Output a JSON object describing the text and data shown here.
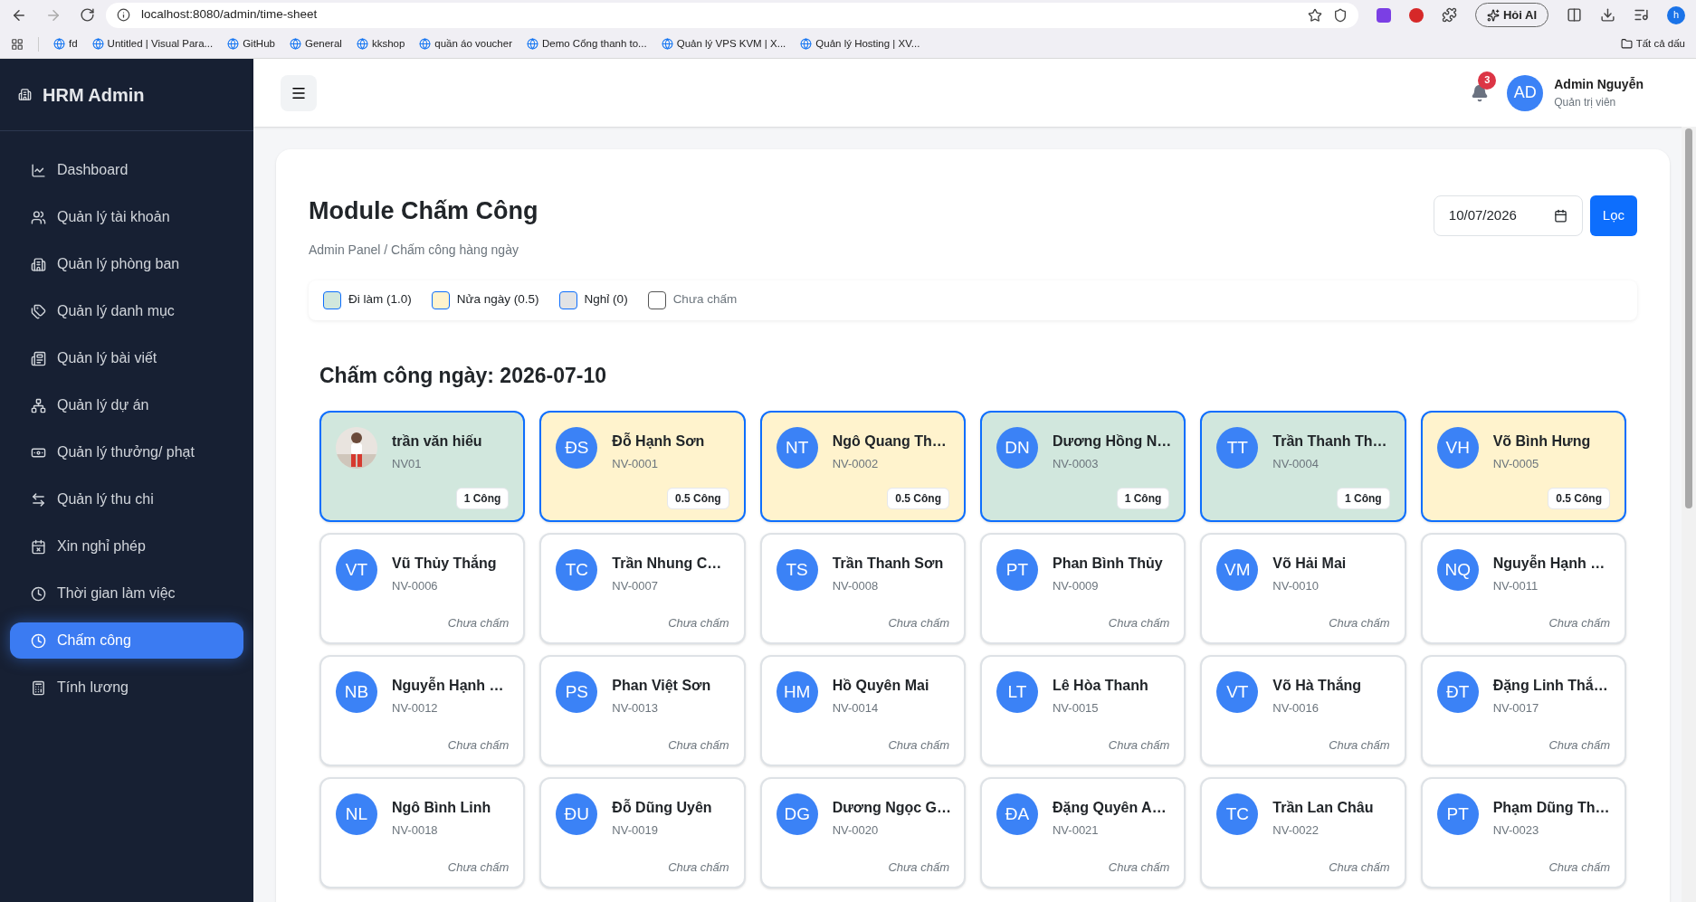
{
  "browser": {
    "url": "localhost:8080/admin/time-sheet",
    "ai_button": "Hỏi AI",
    "profile": "h",
    "bookmarks": [
      {
        "label": "fd"
      },
      {
        "label": "Untitled | Visual Para..."
      },
      {
        "label": "GitHub"
      },
      {
        "label": "General"
      },
      {
        "label": "kkshop"
      },
      {
        "label": "quần áo voucher"
      },
      {
        "label": "Demo Cổng thanh to..."
      },
      {
        "label": "Quản lý VPS KVM | X..."
      },
      {
        "label": "Quản lý Hosting | XV..."
      }
    ],
    "all_bookmarks": "Tất cả dấu"
  },
  "sidebar": {
    "brand": "HRM Admin",
    "items": [
      {
        "label": "Dashboard",
        "selected": false
      },
      {
        "label": "Quản lý tài khoản",
        "selected": false
      },
      {
        "label": "Quản lý phòng ban",
        "selected": false
      },
      {
        "label": "Quản lý danh mục",
        "selected": false
      },
      {
        "label": "Quản lý bài viết",
        "selected": false
      },
      {
        "label": "Quản lý dự án",
        "selected": false
      },
      {
        "label": "Quản lý thưởng/ phạt",
        "selected": false
      },
      {
        "label": "Quản lý thu chi",
        "selected": false
      },
      {
        "label": "Xin nghỉ phép",
        "selected": false
      },
      {
        "label": "Thời gian làm việc",
        "selected": false
      },
      {
        "label": "Chấm công",
        "selected": true
      },
      {
        "label": "Tính lương",
        "selected": false
      }
    ]
  },
  "header": {
    "notifications": "3",
    "user": {
      "initials": "AD",
      "name": "Admin Nguyễn",
      "role": "Quản trị viên"
    }
  },
  "page": {
    "title": "Module Chấm Công",
    "breadcrumb": "Admin Panel / Chấm công hàng ngày",
    "date": "10/07/2026",
    "filter_button": "Lọc",
    "legend": [
      {
        "label": "Đi làm (1.0)",
        "color": "#d1e7dd",
        "kind": "marked"
      },
      {
        "label": "Nửa ngày (0.5)",
        "color": "#fff3cd",
        "kind": "marked"
      },
      {
        "label": "Nghỉ (0)",
        "color": "#e2e3e5",
        "kind": "marked"
      },
      {
        "label": "Chưa chấm",
        "color": "#ffffff",
        "kind": "unmarked"
      }
    ],
    "section_title": "Chấm công ngày: 2026-07-10",
    "employees": [
      {
        "name": "trần văn hiếu",
        "code": "NV01",
        "kind": "full",
        "note": "1 Công"
      },
      {
        "avatar": {
          "kind": "initials",
          "text": "ĐS"
        },
        "name": "Đỗ Hạnh Sơn",
        "code": "NV-0001",
        "kind": "half",
        "note": "0.5 Công"
      },
      {
        "avatar": {
          "kind": "initials",
          "text": "NT"
        },
        "name": "Ngô Quang Th…",
        "code": "NV-0002",
        "kind": "half",
        "note": "0.5 Công"
      },
      {
        "avatar": {
          "kind": "initials",
          "text": "DN"
        },
        "name": "Dương Hồng N…",
        "code": "NV-0003",
        "kind": "full",
        "note": "1 Công"
      },
      {
        "avatar": {
          "kind": "initials",
          "text": "TT"
        },
        "name": "Trần Thanh Th…",
        "code": "NV-0004",
        "kind": "full",
        "note": "1 Công"
      },
      {
        "avatar": {
          "kind": "initials",
          "text": "VH"
        },
        "name": "Võ Bình Hưng",
        "code": "NV-0005",
        "kind": "half",
        "note": "0.5 Công"
      },
      {
        "avatar": {
          "kind": "initials",
          "text": "VT"
        },
        "name": "Vũ Thủy Thắng",
        "code": "NV-0006",
        "kind": "none",
        "note": "Chưa chấm"
      },
      {
        "avatar": {
          "kind": "initials",
          "text": "TC"
        },
        "name": "Trần Nhung C…",
        "code": "NV-0007",
        "kind": "none",
        "note": "Chưa chấm"
      },
      {
        "avatar": {
          "kind": "initials",
          "text": "TS"
        },
        "name": "Trần Thanh Sơn",
        "code": "NV-0008",
        "kind": "none",
        "note": "Chưa chấm"
      },
      {
        "avatar": {
          "kind": "initials",
          "text": "PT"
        },
        "name": "Phan Bình Thủy",
        "code": "NV-0009",
        "kind": "none",
        "note": "Chưa chấm"
      },
      {
        "avatar": {
          "kind": "initials",
          "text": "VM"
        },
        "name": "Võ Hải Mai",
        "code": "NV-0010",
        "kind": "none",
        "note": "Chưa chấm"
      },
      {
        "avatar": {
          "kind": "initials",
          "text": "NQ"
        },
        "name": "Nguyễn Hạnh …",
        "code": "NV-0011",
        "kind": "none",
        "note": "Chưa chấm"
      },
      {
        "avatar": {
          "kind": "initials",
          "text": "NB"
        },
        "name": "Nguyễn Hạnh …",
        "code": "NV-0012",
        "kind": "none",
        "note": "Chưa chấm"
      },
      {
        "avatar": {
          "kind": "initials",
          "text": "PS"
        },
        "name": "Phan Việt Sơn",
        "code": "NV-0013",
        "kind": "none",
        "note": "Chưa chấm"
      },
      {
        "avatar": {
          "kind": "initials",
          "text": "HM"
        },
        "name": "Hồ Quyên Mai",
        "code": "NV-0014",
        "kind": "none",
        "note": "Chưa chấm"
      },
      {
        "avatar": {
          "kind": "initials",
          "text": "LT"
        },
        "name": "Lê Hòa Thanh",
        "code": "NV-0015",
        "kind": "none",
        "note": "Chưa chấm"
      },
      {
        "avatar": {
          "kind": "initials",
          "text": "VT"
        },
        "name": "Võ Hà Thắng",
        "code": "NV-0016",
        "kind": "none",
        "note": "Chưa chấm"
      },
      {
        "avatar": {
          "kind": "initials",
          "text": "ĐT"
        },
        "name": "Đặng Linh Thắ…",
        "code": "NV-0017",
        "kind": "none",
        "note": "Chưa chấm"
      },
      {
        "avatar": {
          "kind": "initials",
          "text": "NL"
        },
        "name": "Ngô Bình Linh",
        "code": "NV-0018",
        "kind": "none",
        "note": "Chưa chấm"
      },
      {
        "avatar": {
          "kind": "initials",
          "text": "ĐU"
        },
        "name": "Đỗ Dũng Uyên",
        "code": "NV-0019",
        "kind": "none",
        "note": "Chưa chấm"
      },
      {
        "avatar": {
          "kind": "initials",
          "text": "DG"
        },
        "name": "Dương Ngọc G…",
        "code": "NV-0020",
        "kind": "none",
        "note": "Chưa chấm"
      },
      {
        "avatar": {
          "kind": "initials",
          "text": "ĐA"
        },
        "name": "Đặng Quyên A…",
        "code": "NV-0021",
        "kind": "none",
        "note": "Chưa chấm"
      },
      {
        "avatar": {
          "kind": "initials",
          "text": "TC"
        },
        "name": "Trần Lan Châu",
        "code": "NV-0022",
        "kind": "none",
        "note": "Chưa chấm"
      },
      {
        "avatar": {
          "kind": "initials",
          "text": "PT"
        },
        "name": "Phạm Dũng Th…",
        "code": "NV-0023",
        "kind": "none",
        "note": "Chưa chấm"
      }
    ]
  }
}
